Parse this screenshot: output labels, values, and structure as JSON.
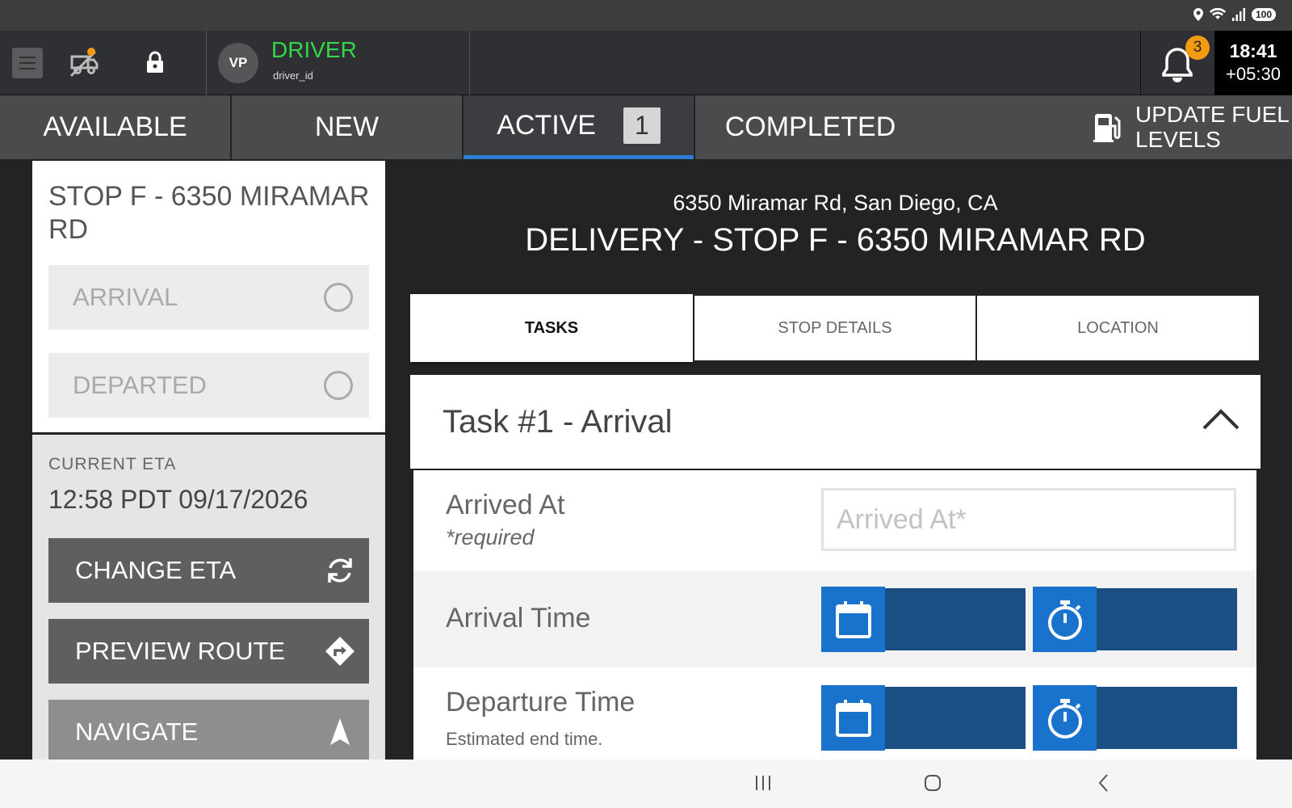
{
  "status_bar": {
    "battery": "100"
  },
  "header": {
    "menu_icon": "hamburger-icon",
    "offline_icon": "no-truck-icon",
    "lock_icon": "lock-icon",
    "avatar_initials": "VP",
    "driver_role": "DRIVER",
    "driver_id": "driver_id",
    "notification_count": "3",
    "clock_time": "18:41",
    "clock_offset": "+05:30"
  },
  "tabs": [
    {
      "label": "AVAILABLE"
    },
    {
      "label": "NEW"
    },
    {
      "label": "ACTIVE",
      "count": "1",
      "active": true
    },
    {
      "label": "COMPLETED"
    }
  ],
  "fuel_button": {
    "label": "UPDATE FUEL LEVELS",
    "icon": "fuel-pump-icon"
  },
  "stop_card": {
    "title": "STOP F - 6350 MIRAMAR RD",
    "arrival_label": "ARRIVAL",
    "departed_label": "DEPARTED"
  },
  "eta": {
    "label": "CURRENT ETA",
    "value": "12:58 PDT 09/17/2026",
    "change_label": "CHANGE ETA",
    "preview_label": "PREVIEW ROUTE",
    "navigate_label": "NAVIGATE"
  },
  "stop": {
    "address": "6350 Miramar Rd, San Diego, CA",
    "heading": "DELIVERY - STOP F - 6350 MIRAMAR RD"
  },
  "subtabs": [
    "TASKS",
    "STOP DETAILS",
    "LOCATION"
  ],
  "task": {
    "title": "Task #1 - Arrival",
    "arrived_at_label": "Arrived At",
    "arrived_at_required": "*required",
    "arrived_at_placeholder": "Arrived At*",
    "arrival_time_label": "Arrival Time",
    "departure_time_label": "Departure Time",
    "departure_time_hint": "Estimated end time."
  },
  "colors": {
    "accent_blue": "#2a7fd4",
    "picker_dark": "#1b4f84",
    "picker_light": "#1972cc",
    "driver_green": "#35d64a",
    "badge_orange": "#f29a10"
  }
}
